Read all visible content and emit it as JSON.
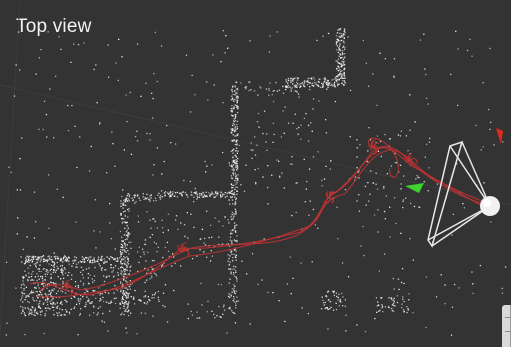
{
  "viewport": {
    "label": "Top view"
  },
  "colors": {
    "background": "#333333",
    "point_cloud": "#f4f4f4",
    "trajectory": "#c83232",
    "axis_x_marker": "#e02a1c",
    "axis_y_marker": "#3fd12e",
    "camera_frustum": "#e8e8e8",
    "camera_center": "#f5f5f5"
  },
  "icons": {
    "camera": "camera-frustum-icon",
    "x_marker": "red-axis-marker-icon",
    "y_marker": "green-axis-marker-icon"
  }
}
